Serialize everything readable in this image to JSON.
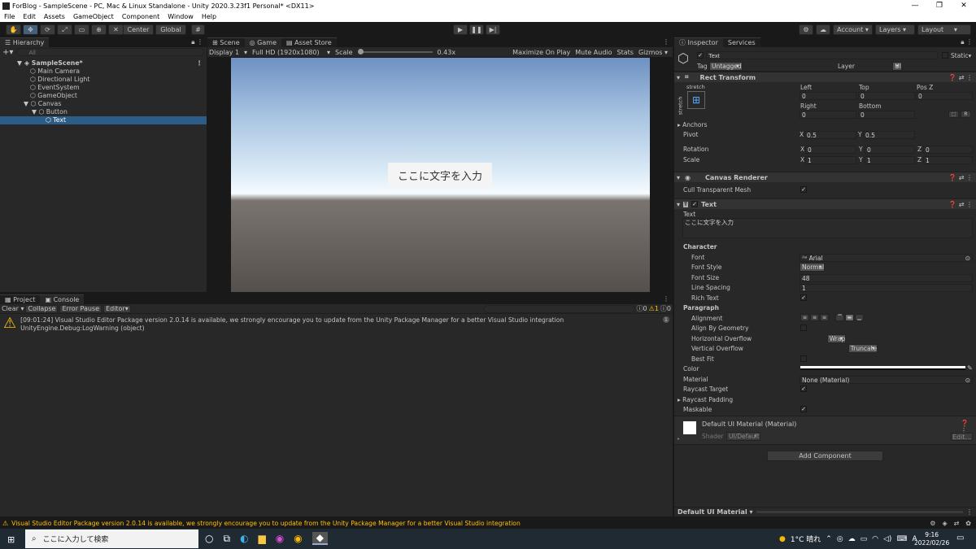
{
  "window": {
    "title": "ForBlog - SampleScene - PC, Mac & Linux Standalone - Unity 2020.3.23f1 Personal* <DX11>"
  },
  "menu": [
    "File",
    "Edit",
    "Assets",
    "GameObject",
    "Component",
    "Window",
    "Help"
  ],
  "toolbar": {
    "center_label": "Center",
    "global_label": "Global",
    "account_label": "Account",
    "layers_label": "Layers",
    "layout_label": "Layout"
  },
  "hierarchy": {
    "tab_label": "Hierarchy",
    "search_placeholder": "All",
    "items": [
      {
        "label": "SampleScene*",
        "depth": 0,
        "expander": "▼",
        "scene": true
      },
      {
        "label": "Main Camera",
        "depth": 1,
        "expander": ""
      },
      {
        "label": "Directional Light",
        "depth": 1,
        "expander": ""
      },
      {
        "label": "EventSystem",
        "depth": 1,
        "expander": ""
      },
      {
        "label": "GameObject",
        "depth": 1,
        "expander": ""
      },
      {
        "label": "Canvas",
        "depth": 1,
        "expander": "▼"
      },
      {
        "label": "Button",
        "depth": 2,
        "expander": "▼"
      },
      {
        "label": "Text",
        "depth": 3,
        "expander": "",
        "selected": true
      }
    ]
  },
  "scene": {
    "tabs": [
      "Scene",
      "Game",
      "Asset Store"
    ],
    "display": "Display 1",
    "resolution": "Full HD (1920x1080)",
    "scale_label": "Scale",
    "scale_value": "0.43x",
    "right_buttons": [
      "Maximize On Play",
      "Mute Audio",
      "Stats",
      "Gizmos"
    ],
    "button_text": "ここに文字を入力"
  },
  "console": {
    "tabs": [
      "Project",
      "Console"
    ],
    "buttons": [
      "Clear",
      "Collapse",
      "Error Pause",
      "Editor"
    ],
    "counts": {
      "errors": "0",
      "warnings": "1",
      "infos": "0"
    },
    "message_line1": "[09:01:24] Visual Studio Editor Package version 2.0.14 is available, we strongly encourage you to update from the Unity Package Manager for a better Visual Studio integration",
    "message_line2": "UnityEngine.Debug:LogWarning (object)",
    "message_count": "1"
  },
  "inspector": {
    "tabs": [
      "Inspector",
      "Services"
    ],
    "object_name": "Text",
    "static_label": "Static",
    "tag_label": "Tag",
    "tag_value": "Untagged",
    "layer_label": "Layer",
    "layer_value": "UI",
    "rect_transform": {
      "title": "Rect Transform",
      "anchor_top": "stretch",
      "anchor_side": "stretch",
      "left_label": "Left",
      "left": "0",
      "top_label": "Top",
      "top": "0",
      "posz_label": "Pos Z",
      "posz": "0",
      "right_label": "Right",
      "right": "0",
      "bottom_label": "Bottom",
      "bottom": "0",
      "anchors_label": "Anchors",
      "pivot_label": "Pivot",
      "pivot_x": "0.5",
      "pivot_y": "0.5",
      "rotation_label": "Rotation",
      "rot_x": "0",
      "rot_y": "0",
      "rot_z": "0",
      "scale_label": "Scale",
      "scale_x": "1",
      "scale_y": "1",
      "scale_z": "1"
    },
    "canvas_renderer": {
      "title": "Canvas Renderer",
      "cull_label": "Cull Transparent Mesh"
    },
    "text": {
      "title": "Text",
      "text_label": "Text",
      "text_value": "ここに文字を入力",
      "character_label": "Character",
      "font_label": "Font",
      "font_value": "Arial",
      "font_style_label": "Font Style",
      "font_style_value": "Normal",
      "font_size_label": "Font Size",
      "font_size_value": "48",
      "line_spacing_label": "Line Spacing",
      "line_spacing_value": "1",
      "rich_text_label": "Rich Text",
      "paragraph_label": "Paragraph",
      "alignment_label": "Alignment",
      "align_geometry_label": "Align By Geometry",
      "h_overflow_label": "Horizontal Overflow",
      "h_overflow_value": "Wrap",
      "v_overflow_label": "Vertical Overflow",
      "v_overflow_value": "Truncate",
      "best_fit_label": "Best Fit",
      "color_label": "Color",
      "material_label": "Material",
      "material_value": "None (Material)",
      "raycast_target_label": "Raycast Target",
      "raycast_padding_label": "Raycast Padding",
      "maskable_label": "Maskable"
    },
    "material": {
      "title": "Default UI Material (Material)",
      "shader_label": "Shader",
      "shader_value": "UI/Default",
      "edit_label": "Edit..."
    },
    "add_component": "Add Component",
    "footer_label": "Default UI Material"
  },
  "status_bar": {
    "message": "Visual Studio Editor Package version 2.0.14 is available, we strongly encourage you to update from the Unity Package Manager for a better Visual Studio integration"
  },
  "taskbar": {
    "search_placeholder": "ここに入力して検索",
    "weather": "1°C 晴れ",
    "ime": "A",
    "time": "9:16",
    "date": "2022/02/26"
  },
  "colors": {
    "accent": "#2c5d87",
    "warning": "#ffc107",
    "unity_dark": "#282828"
  }
}
